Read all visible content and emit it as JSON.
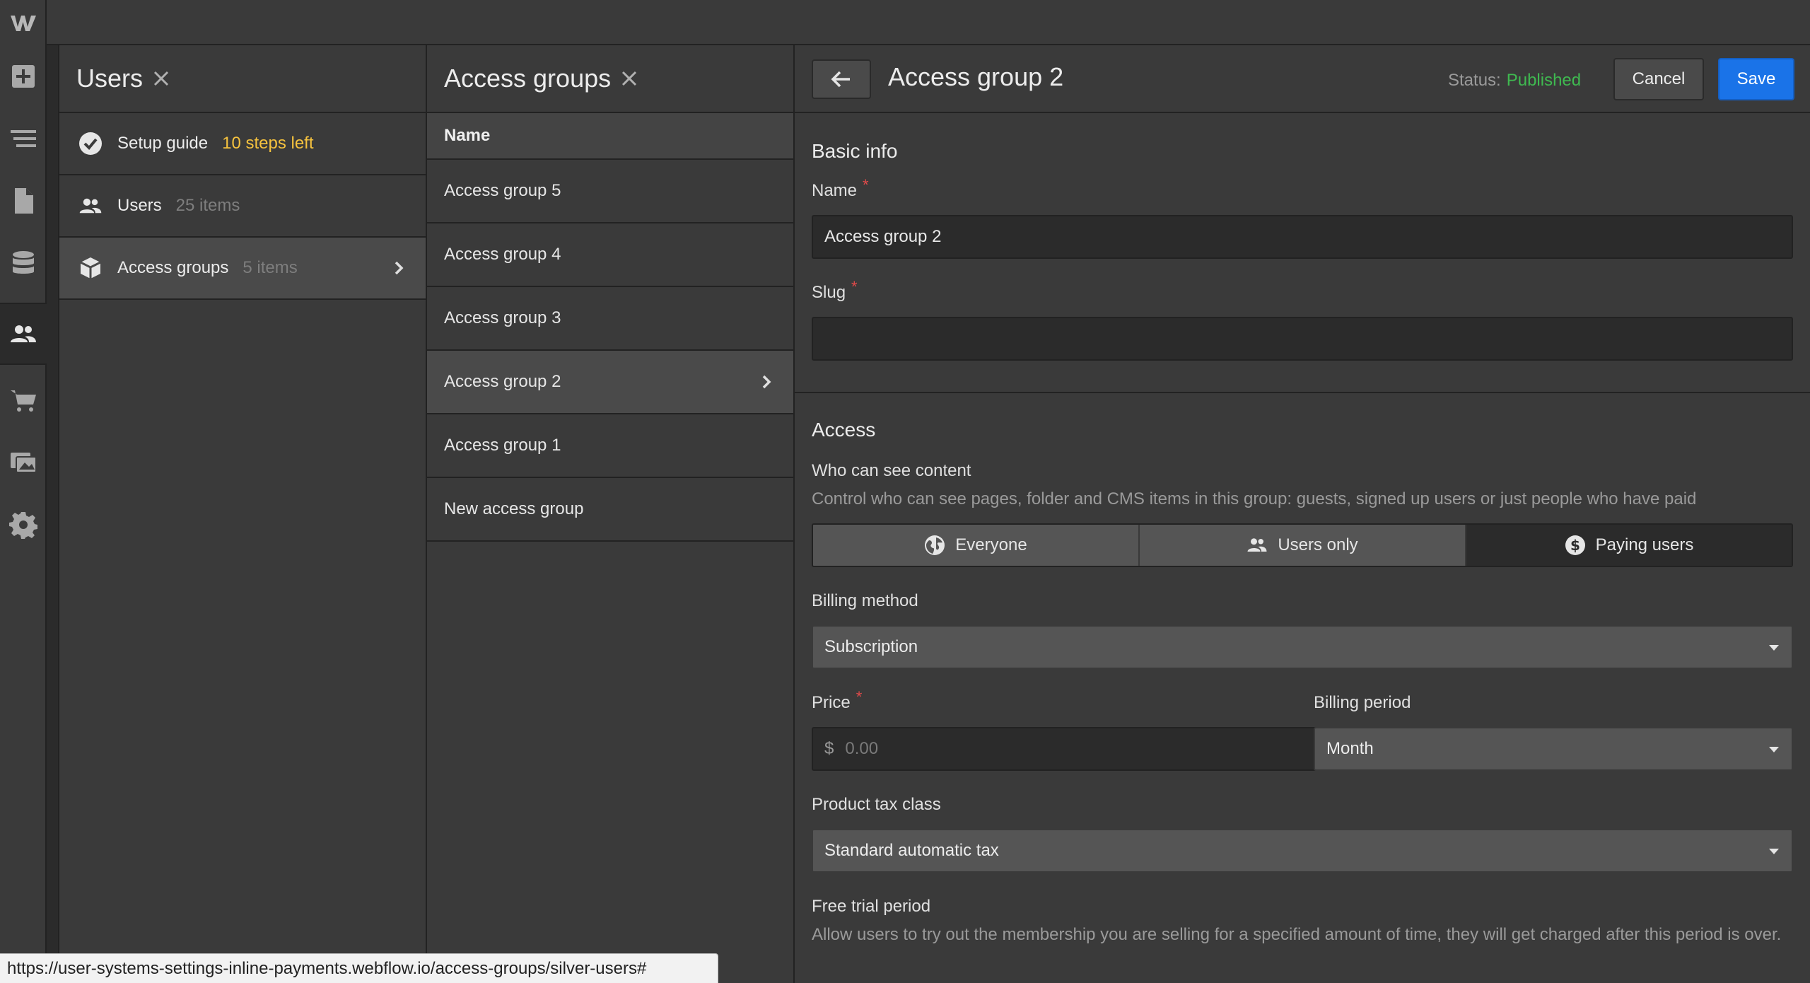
{
  "rail": {
    "items": [
      {
        "name": "add"
      },
      {
        "name": "navigator"
      },
      {
        "name": "pages"
      },
      {
        "name": "cms"
      },
      {
        "name": "users",
        "active": true
      },
      {
        "name": "ecommerce"
      },
      {
        "name": "assets"
      },
      {
        "name": "settings"
      }
    ]
  },
  "users_panel": {
    "title": "Users",
    "items": [
      {
        "label": "Setup guide",
        "meta": "10 steps left",
        "icon": "check-circle-icon"
      },
      {
        "label": "Users",
        "meta": "25 items",
        "icon": "users-icon"
      },
      {
        "label": "Access groups",
        "meta": "5 items",
        "icon": "cube-icon",
        "selected": true
      }
    ]
  },
  "groups_panel": {
    "title": "Access groups",
    "column_header": "Name",
    "items": [
      {
        "label": "Access group 5"
      },
      {
        "label": "Access group 4"
      },
      {
        "label": "Access group 3"
      },
      {
        "label": "Access group 2",
        "selected": true
      },
      {
        "label": "Access group 1"
      },
      {
        "label": "New access group"
      }
    ]
  },
  "detail": {
    "title": "Access group 2",
    "status_label": "Status:",
    "status_value": "Published",
    "cancel_label": "Cancel",
    "save_label": "Save",
    "basic_info": {
      "title": "Basic info",
      "name_label": "Name",
      "name_value": "Access group 2",
      "slug_label": "Slug",
      "slug_value": ""
    },
    "access": {
      "title": "Access",
      "who_label": "Who can see content",
      "who_desc": "Control who can see pages, folder and CMS items in this group: guests, signed up users or just people who have paid",
      "options": [
        {
          "label": "Everyone",
          "icon": "globe-icon"
        },
        {
          "label": "Users only",
          "icon": "users-icon"
        },
        {
          "label": "Paying users",
          "icon": "dollar-icon",
          "active": true
        }
      ],
      "billing_method_label": "Billing method",
      "billing_method_value": "Subscription",
      "price_label": "Price",
      "price_currency": "$",
      "price_placeholder": "0.00",
      "billing_period_label": "Billing period",
      "billing_period_value": "Month",
      "tax_label": "Product tax class",
      "tax_value": "Standard automatic tax",
      "trial_label": "Free trial period",
      "trial_desc": "Allow users to try out the membership you are selling for a specified amount of time, they will get charged after this period is over."
    }
  },
  "status_bar": {
    "url": "https://user-systems-settings-inline-payments.webflow.io/access-groups/silver-users#"
  },
  "colors": {
    "accent": "#1a73e8",
    "published": "#3fb950",
    "warning": "#f5c23e",
    "required": "#e14a4a"
  }
}
